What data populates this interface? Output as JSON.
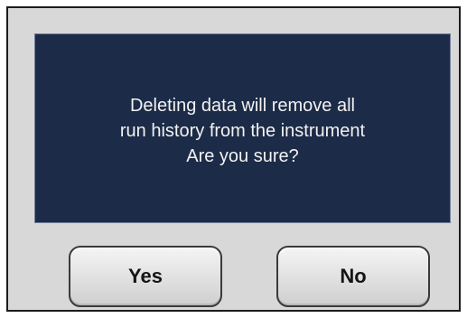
{
  "dialog": {
    "message_lines": [
      "Deleting data will remove all",
      "run history from the instrument",
      "Are you sure?"
    ],
    "yes_label": "Yes",
    "no_label": "No"
  },
  "colors": {
    "frame_background": "#d8d8d8",
    "message_panel_background": "#1c2b47",
    "message_text": "#f2f2f2",
    "button_border": "#3a3a3a"
  }
}
